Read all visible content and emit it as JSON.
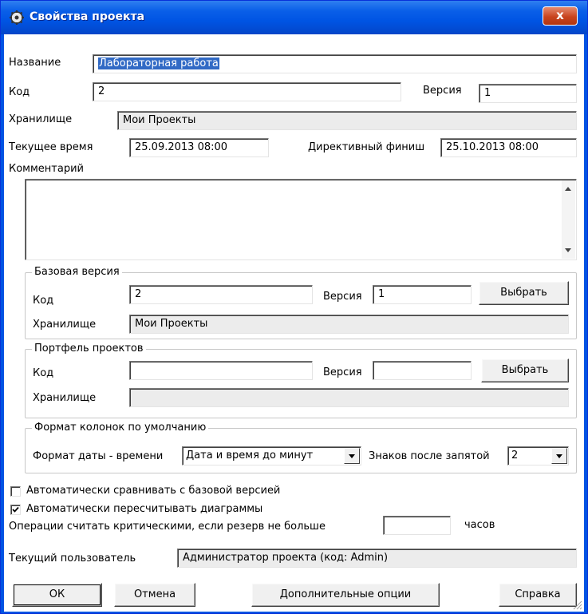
{
  "window": {
    "title": "Свойства проекта",
    "close": "x"
  },
  "project": {
    "name_label": "Название",
    "name_value": "Лабораторная работа",
    "code_label": "Код",
    "code_value": "2",
    "version_label": "Версия",
    "version_value": "1",
    "storage_label": "Хранилище",
    "storage_value": "Мои Проекты",
    "current_time_label": "Текущее время",
    "current_time_value": "25.09.2013 08:00",
    "deadline_label": "Директивный финиш",
    "deadline_value": "25.10.2013 08:00",
    "comment_label": "Комментарий",
    "comment_value": ""
  },
  "base_version": {
    "title": "Базовая версия",
    "code_label": "Код",
    "code_value": "2",
    "version_label": "Версия",
    "version_value": "1",
    "select_button": "Выбрать",
    "storage_label": "Хранилище",
    "storage_value": "Мои Проекты"
  },
  "portfolio": {
    "title": "Портфель проектов",
    "code_label": "Код",
    "code_value": "",
    "version_label": "Версия",
    "version_value": "",
    "select_button": "Выбрать",
    "storage_label": "Хранилище",
    "storage_value": ""
  },
  "column_format": {
    "title": "Формат колонок по умолчанию",
    "datetime_label": "Формат даты - времени",
    "datetime_value": "Дата и время до минут",
    "decimals_label": "Знаков после запятой",
    "decimals_value": "2"
  },
  "options": {
    "auto_compare_label": "Автоматически сравнивать с базовой версией",
    "auto_compare_checked": false,
    "auto_recalc_label": "Автоматически пересчитывать диаграммы",
    "auto_recalc_checked": true,
    "critical_label": "Операции считать критическими, если резерв не больше",
    "critical_value": "",
    "critical_unit": "часов"
  },
  "user": {
    "label": "Текущий пользователь",
    "value": "Администратор проекта (код: Admin)"
  },
  "buttons": {
    "ok": "ОК",
    "cancel": "Отмена",
    "more": "Дополнительные опции",
    "help": "Справка"
  }
}
